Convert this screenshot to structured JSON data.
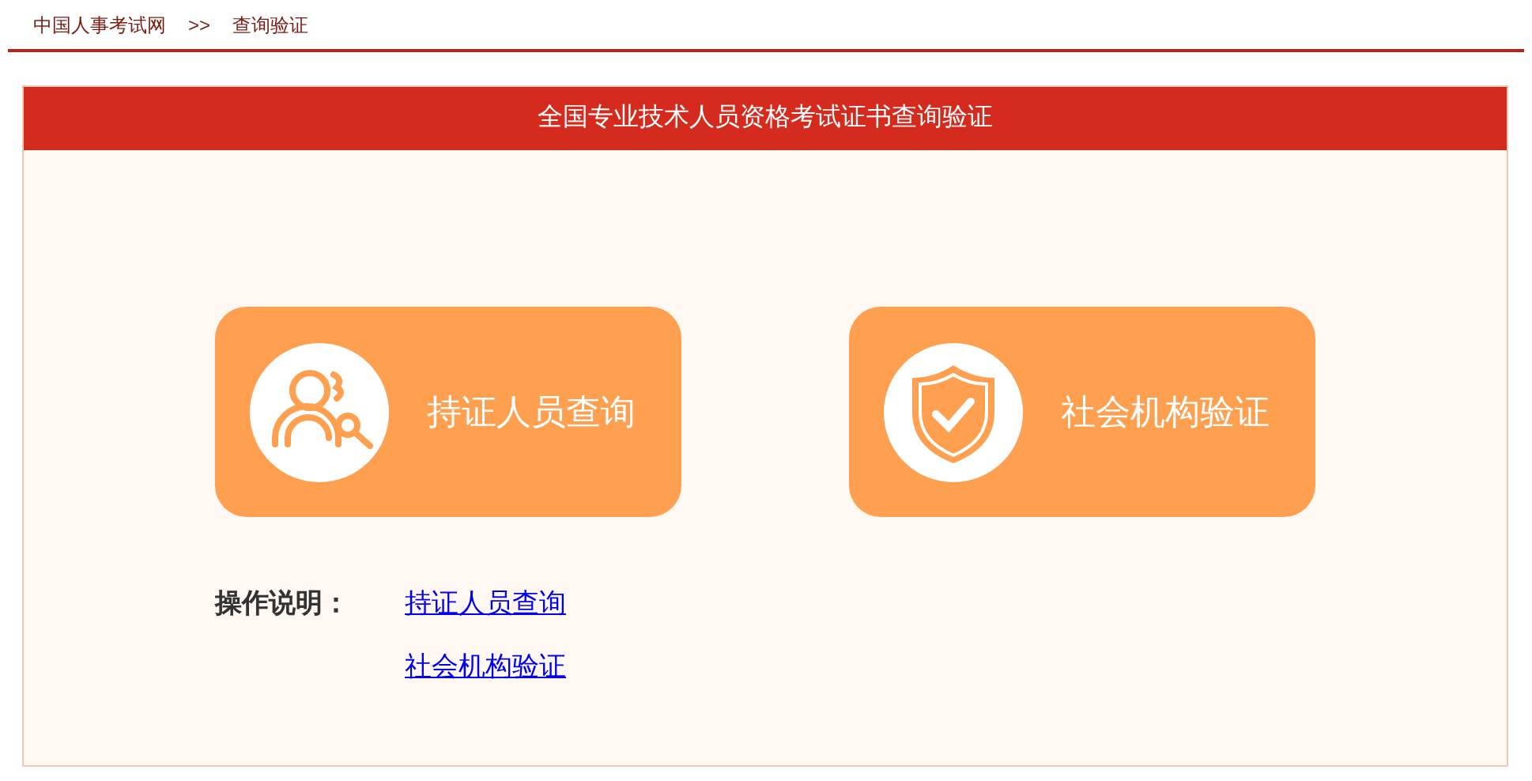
{
  "breadcrumb": {
    "items": [
      "中国人事考试网",
      "查询验证"
    ],
    "separator": ">>"
  },
  "panel": {
    "title": "全国专业技术人员资格考试证书查询验证",
    "cards": [
      {
        "kind": "person-search",
        "label": "持证人员查询"
      },
      {
        "kind": "shield",
        "label": "社会机构验证"
      }
    ],
    "instructions": {
      "label": "操作说明：",
      "links": [
        "持证人员查询",
        "社会机构验证"
      ]
    }
  }
}
